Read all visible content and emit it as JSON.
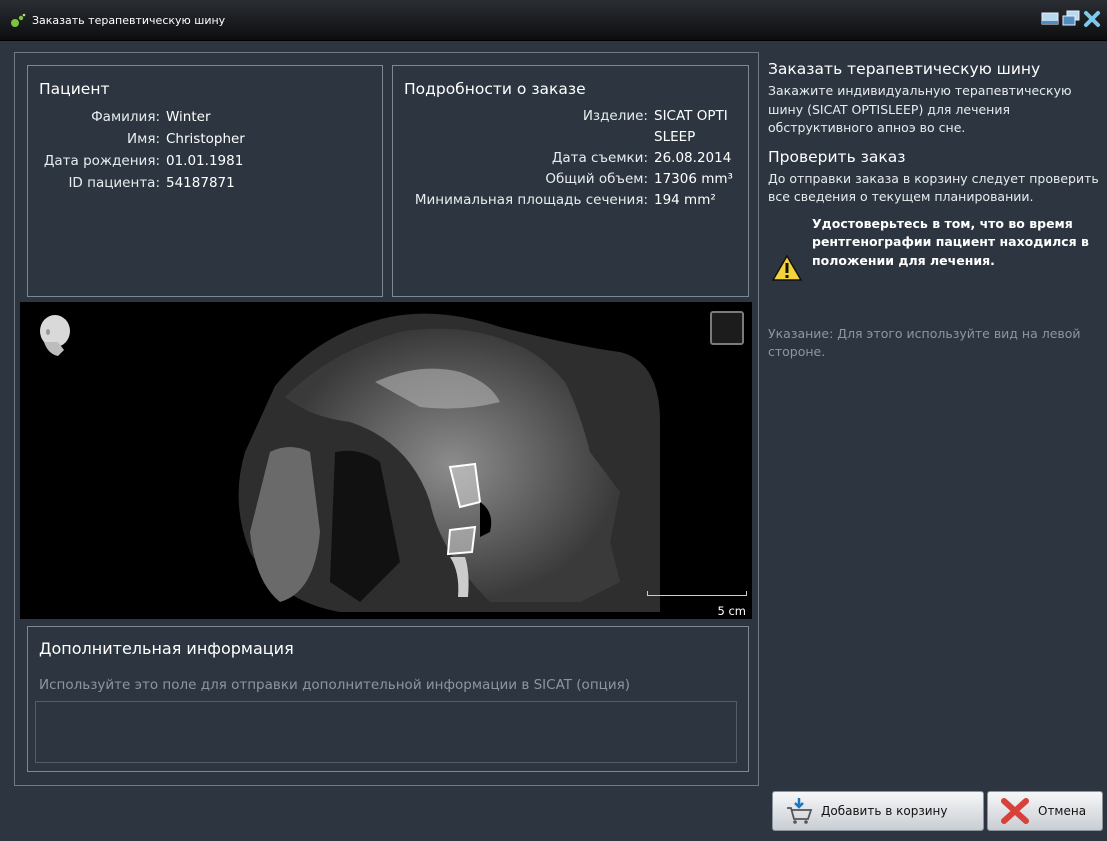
{
  "window": {
    "title": "Заказать терапевтическую шину"
  },
  "patient": {
    "title": "Пациент",
    "fields": [
      {
        "label": "Фамилия:",
        "value": "Winter"
      },
      {
        "label": "Имя:",
        "value": "Christopher"
      },
      {
        "label": "Дата рождения:",
        "value": "01.01.1981"
      },
      {
        "label": "ID пациента:",
        "value": "54187871"
      }
    ]
  },
  "order": {
    "title": "Подробности о заказе",
    "fields": [
      {
        "label": "Изделие:",
        "value": "SICAT OPTISLEEP"
      },
      {
        "label": "Дата съемки:",
        "value": "26.08.2014"
      },
      {
        "label": "Общий объем:",
        "value": "17306 mm³"
      },
      {
        "label": "Минимальная площадь сечения:",
        "value": "194 mm²"
      }
    ]
  },
  "viewer": {
    "scale_label": "5 cm"
  },
  "additional": {
    "title": "Дополнительная информация",
    "hint": "Используйте это поле для отправки дополнительной информации в SICAT (опция)",
    "value": ""
  },
  "sidebar": {
    "title": "Заказать терапевтическую шину",
    "description": "Закажите индивидуальную терапевтическую шину (SICAT OPTISLEEP) для лечения обструктивного апноэ во сне.",
    "check_title": "Проверить заказ",
    "check_text": "До отправки заказа в корзину следует проверить все сведения о текущем планировании.",
    "warning": "Удостоверьтесь в том, что во время рентгенографии пациент находился в положении для лечения.",
    "note": "Указание: Для этого используйте вид на левой стороне."
  },
  "buttons": {
    "add_to_cart": "Добавить в корзину",
    "cancel": "Отмена"
  },
  "icons": [
    "app-logo-icon",
    "window-layout-icon",
    "window-restore-icon",
    "close-icon",
    "head-orientation-icon",
    "warning-icon",
    "cart-icon",
    "cancel-x-icon"
  ]
}
